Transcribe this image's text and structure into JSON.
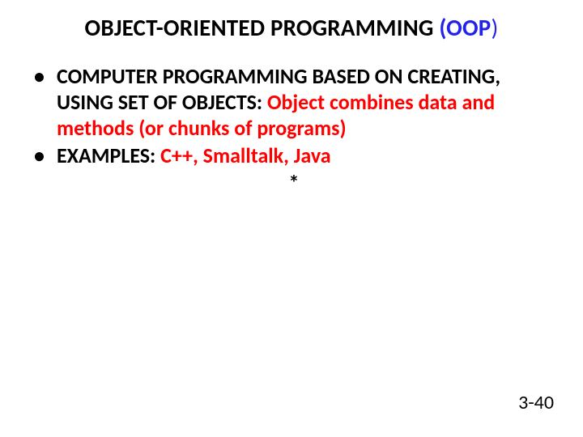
{
  "title": {
    "prefix": "OBJECT-ORIENTED PROGRAMMING",
    "oop_open": "(OOP",
    "close_paren": ")"
  },
  "bullets": [
    {
      "lead": "COMPUTER PROGRAMMING BASED ON CREATING, USING SET OF OBJECTS: ",
      "red": "Object combines data and methods (or chunks of programs)"
    },
    {
      "lead": "EXAMPLES: ",
      "red": "C++, Smalltalk, Java"
    }
  ],
  "star": "*",
  "page_number": "3-40"
}
